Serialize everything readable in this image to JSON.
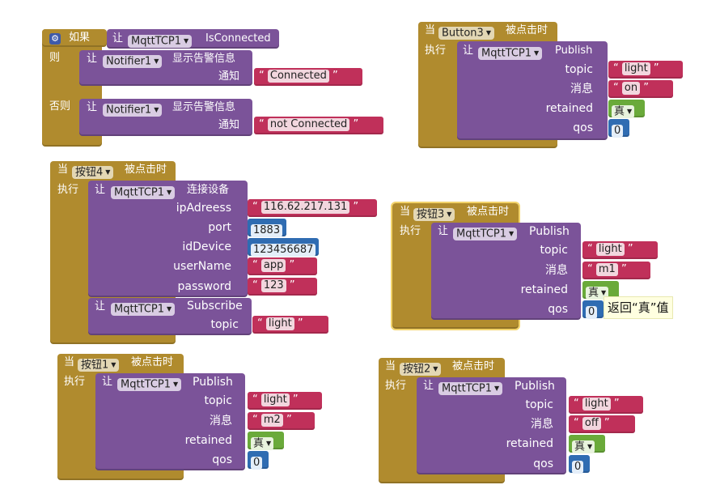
{
  "labels": {
    "when": "当",
    "clicked": "被点击时",
    "do": "执行",
    "if": "如果",
    "then": "则",
    "else": "否则",
    "call": "让",
    "notify": "通知",
    "publish": "Publish",
    "subscribe": "Subscribe",
    "connect": "连接设备",
    "show_alert": "显示告警信息",
    "is_connected": "IsConnected",
    "topic": "topic",
    "message": "消息",
    "retained": "retained",
    "qos": "qos",
    "ip": "ipAdreess",
    "port": "port",
    "id_device": "idDevice",
    "user_name": "userName",
    "password": "password",
    "true_val": "真",
    "tooltip": "返回“真”值"
  },
  "components": {
    "mqtt": "MqttTCP1",
    "notifier": "Notifier1",
    "button3_en": "Button3",
    "btn4": "按钮4",
    "btn3": "按钮3",
    "btn1": "按钮1",
    "btn2": "按钮2"
  },
  "values": {
    "connected": "Connected",
    "not_connected": "not Connected",
    "light": "light",
    "on": "on",
    "m1": "m1",
    "m2": "m2",
    "off": "off",
    "ip": "116.62.217.131",
    "port": "1883",
    "id_device": "123456687",
    "user_name": "app",
    "password": "123",
    "qos": "0"
  },
  "colors": {
    "event": "#B08B2E",
    "procedure": "#7B5399",
    "text": "#C0305A",
    "math": "#2F6CB2",
    "logic": "#6AAA3A",
    "control": "#B08B2E"
  }
}
